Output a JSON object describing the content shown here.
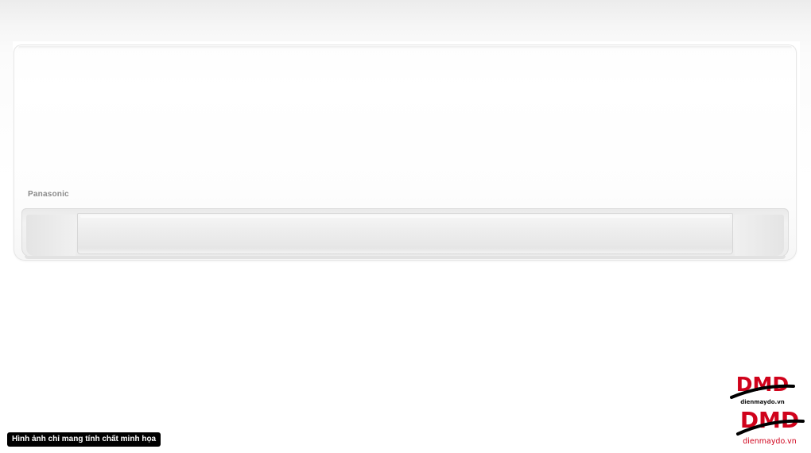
{
  "product": {
    "brand": "Panasonic",
    "subject": "wall-mounted air conditioner indoor unit",
    "color": "#ffffff"
  },
  "overlay": {
    "disclaimer": "Hình ảnh chỉ mang tính chất minh họa"
  },
  "watermarks": [
    {
      "text": "DMD",
      "subtext": "dienmaydo.vn",
      "color": "#d0021b"
    },
    {
      "text": "DMD",
      "subtext": "dienmaydo.vn",
      "color": "#d0021b"
    }
  ]
}
